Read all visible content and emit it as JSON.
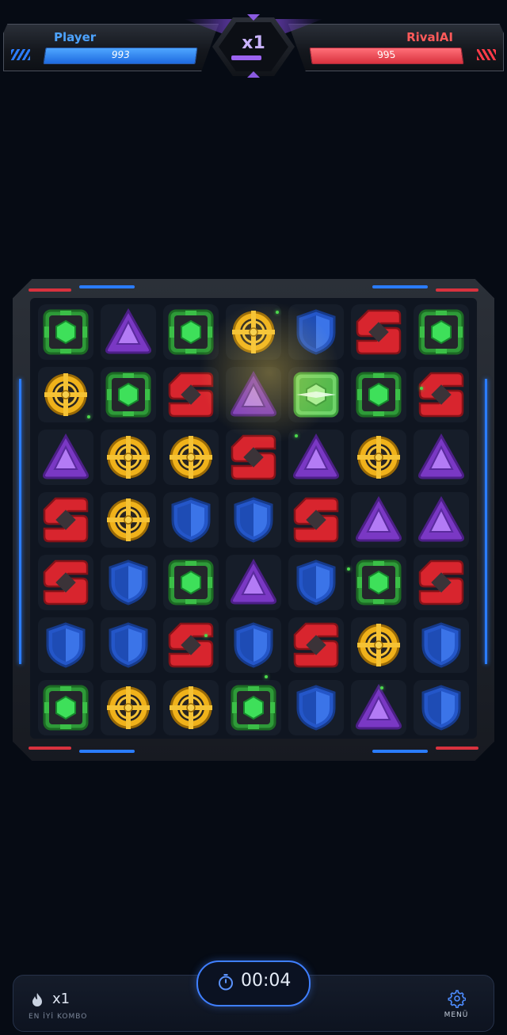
{
  "hud": {
    "player_name": "Player",
    "player_score": "993",
    "player_bar_fraction": 1.0,
    "rival_name": "RivalAI",
    "rival_score": "995",
    "rival_bar_fraction": 1.0,
    "multiplier": "x1",
    "multiplier_fraction": 1.0,
    "colors": {
      "player": "#4da3ff",
      "rival": "#ff5a5a",
      "multiplier": "#9b63f0"
    }
  },
  "board": {
    "rows": 7,
    "cols": 7,
    "gem_types": {
      "G": "green-hex-gem",
      "P": "purple-triangle-gem",
      "Y": "yellow-target-gem",
      "B": "blue-shield-gem",
      "R": "red-s-gem",
      "Gs": "green-hex-gem-selected"
    },
    "cells": [
      [
        "G",
        "P",
        "G",
        "Y",
        "B",
        "R",
        "G"
      ],
      [
        "Y",
        "G",
        "R",
        "P",
        "Gs",
        "G",
        "R"
      ],
      [
        "P",
        "Y",
        "Y",
        "R",
        "P",
        "Y",
        "P"
      ],
      [
        "R",
        "Y",
        "B",
        "B",
        "R",
        "P",
        "P"
      ],
      [
        "R",
        "B",
        "G",
        "P",
        "B",
        "G",
        "R"
      ],
      [
        "B",
        "B",
        "R",
        "B",
        "R",
        "Y",
        "B"
      ],
      [
        "G",
        "Y",
        "Y",
        "G",
        "B",
        "P",
        "B"
      ]
    ]
  },
  "footer": {
    "combo_value": "x1",
    "combo_label": "EN İYİ KOMBO",
    "timer": "00:04",
    "menu_label": "MENÜ",
    "menu_icon": "gear-icon",
    "combo_icon": "flame-icon",
    "timer_icon": "stopwatch-icon"
  }
}
